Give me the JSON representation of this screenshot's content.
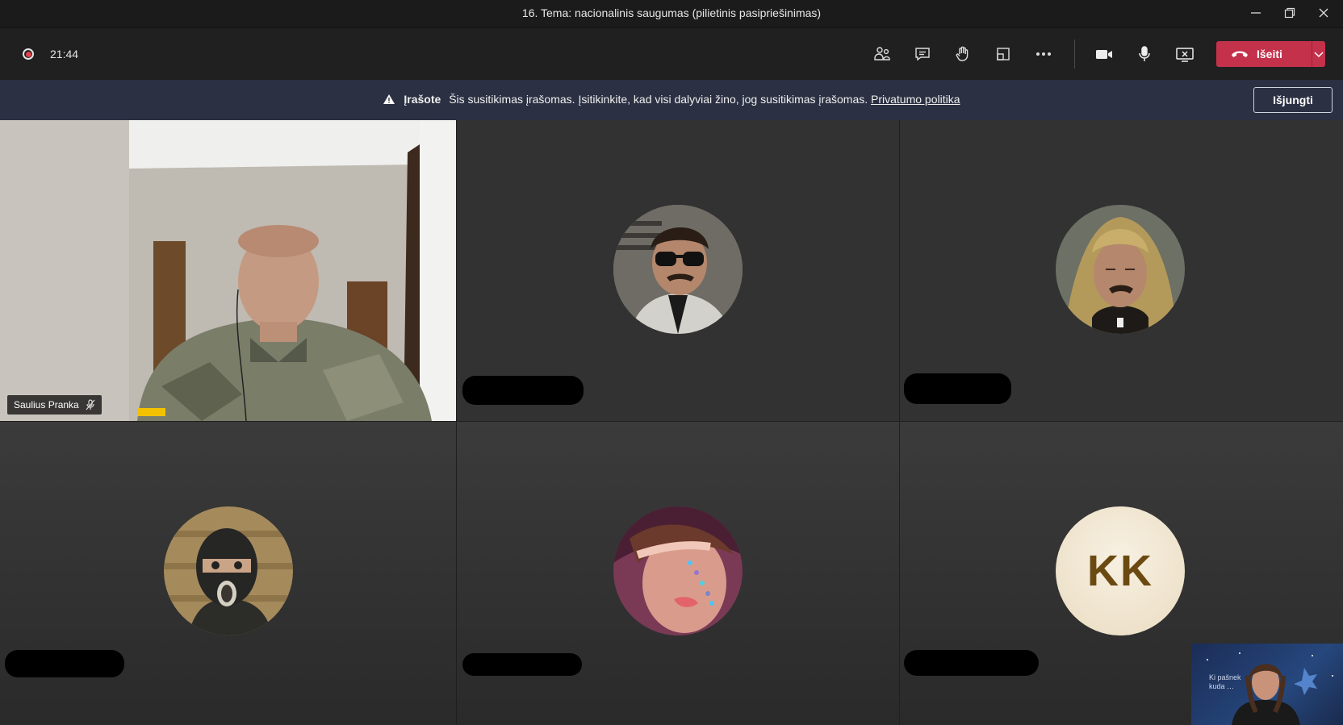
{
  "window": {
    "title": "16. Tema: nacionalinis saugumas (pilietinis pasipriešinimas)"
  },
  "toolbar": {
    "timer": "21:44",
    "leave_label": "Išeiti",
    "buttons": [
      "people-icon",
      "chat-icon",
      "raise-hand-icon",
      "view-icon",
      "more-icon",
      "camera-icon",
      "mic-icon",
      "share-icon"
    ]
  },
  "banner": {
    "title": "Įrašote",
    "message": "Šis susitikimas įrašomas. Įsitikinkite, kad visi dalyviai žino, jog susitikimas įrašomas.",
    "link": "Privatumo politika",
    "turn_off": "Išjungti"
  },
  "participants": [
    {
      "name": "Saulius Pranka",
      "muted": true,
      "video": true
    },
    {
      "name": "",
      "avatar": "photo"
    },
    {
      "name": "",
      "avatar": "photo"
    },
    {
      "name": "",
      "avatar": "photo"
    },
    {
      "name": "",
      "avatar": "photo"
    },
    {
      "name": "",
      "avatar_initials": "KK"
    }
  ],
  "colors": {
    "leave": "#c4314b",
    "banner": "#2b3042",
    "tile": "#323232"
  }
}
